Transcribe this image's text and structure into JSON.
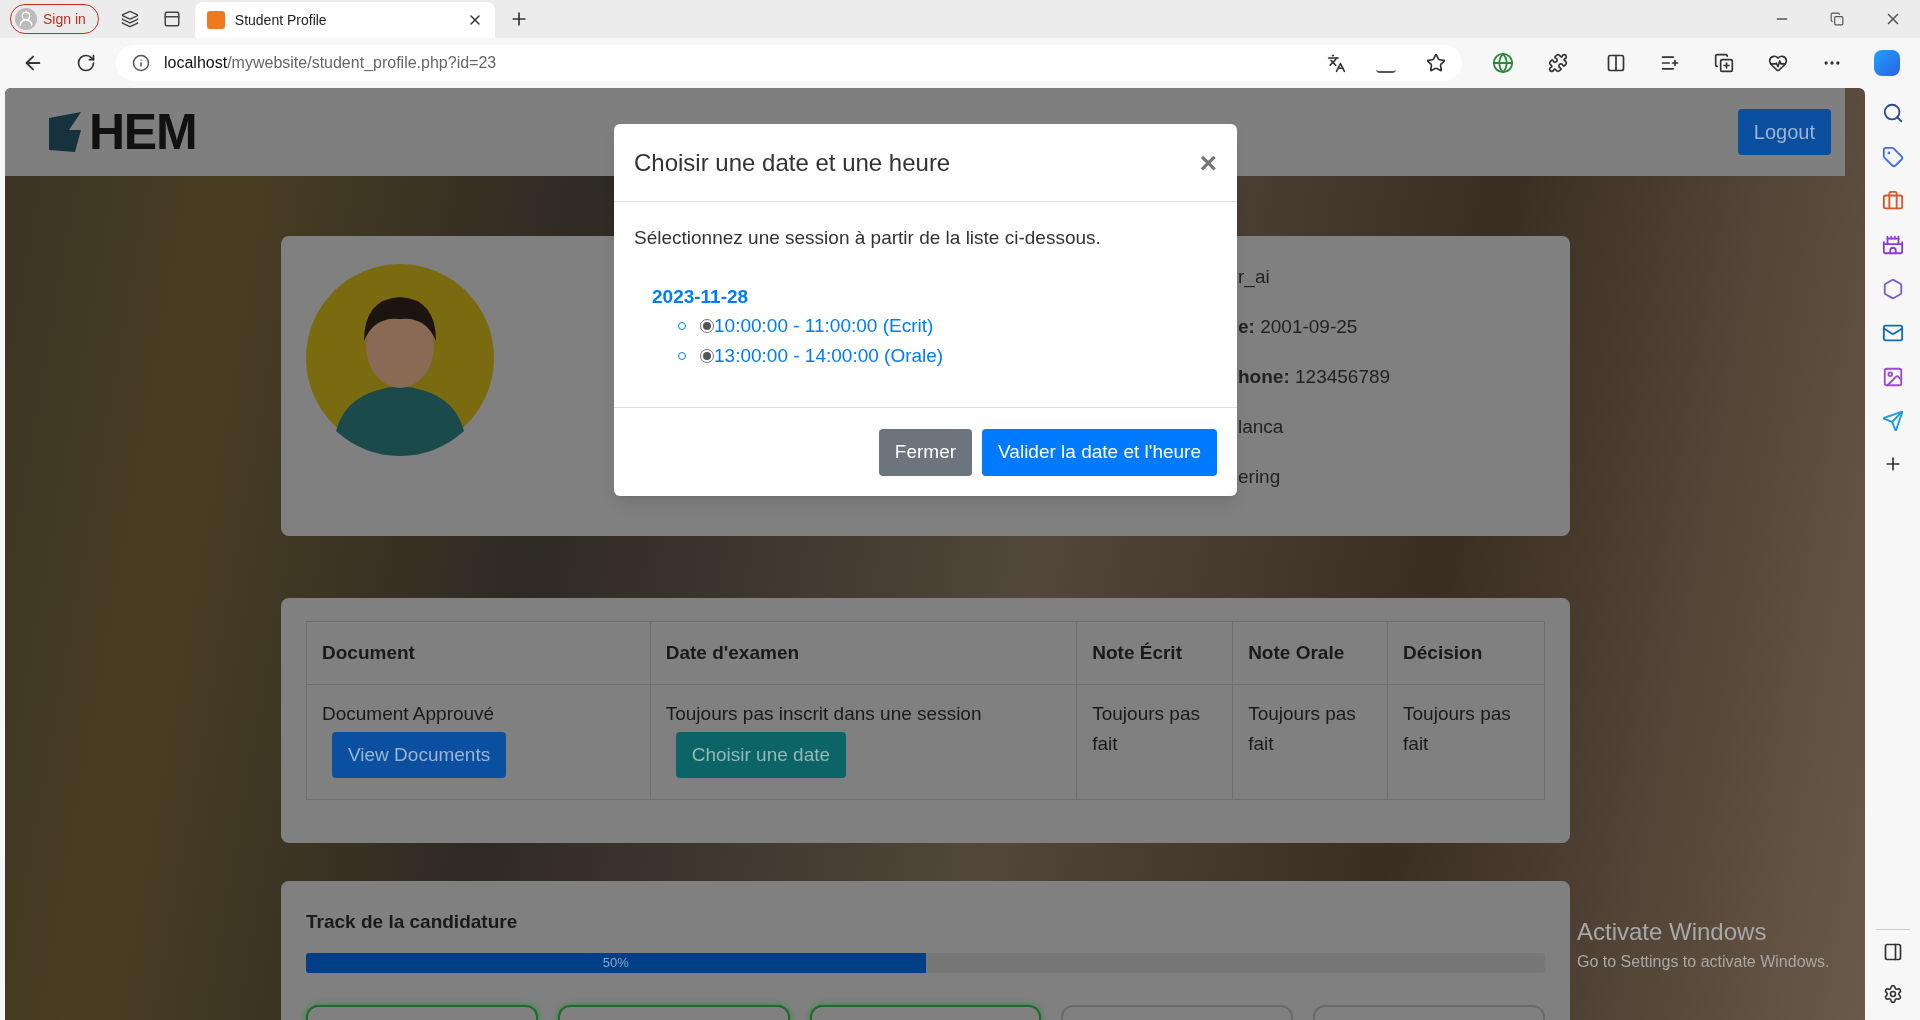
{
  "browser": {
    "sign_in": "Sign in",
    "tabs": [
      {
        "title": "Student Profile",
        "selected": true
      }
    ],
    "url_host": "localhost",
    "url_path": "/mywebsite/student_profile.php?id=23"
  },
  "header": {
    "logo": "HEM",
    "logout": "Logout"
  },
  "profile": {
    "fields": [
      {
        "value": "r_ai"
      },
      {
        "label": "e:",
        "value": "2001-09-25"
      },
      {
        "label": "hone:",
        "value": "123456789"
      },
      {
        "value": "lanca"
      },
      {
        "value": "ering"
      }
    ]
  },
  "table": {
    "columns": [
      "Document",
      "Date d'examen",
      "Note Écrit",
      "Note Orale",
      "Décision"
    ],
    "rows": [
      {
        "cells": [
          {
            "text": "Document Approuvé",
            "button": {
              "label": "View Documents",
              "kind": "primary"
            }
          },
          {
            "text": "Toujours pas inscrit dans une session",
            "button": {
              "label": "Choisir une date",
              "kind": "info"
            }
          },
          {
            "text": "Toujours pas fait"
          },
          {
            "text": "Toujours pas fait"
          },
          {
            "text": "Toujours pas fait"
          }
        ]
      }
    ]
  },
  "track": {
    "title": "Track de la candidature",
    "progress": {
      "level": 0.5,
      "label": "50%"
    },
    "steps": [
      {
        "done": true
      },
      {
        "done": true
      },
      {
        "done": true
      },
      {
        "done": false
      },
      {
        "done": false
      }
    ]
  },
  "modal": {
    "title": "Choisir une date et une heure",
    "close": "×",
    "instruction": "Sélectionnez une session à partir de la liste ci-dessous.",
    "dates": [
      {
        "date": "2023-11-28",
        "sessions": [
          "10:00:00 - 11:00:00 (Ecrit)",
          "13:00:00 - 14:00:00 (Orale)"
        ]
      }
    ],
    "buttons": [
      {
        "label": "Fermer",
        "kind": "secondary"
      },
      {
        "label": "Valider la date et l'heure",
        "kind": "primary"
      }
    ]
  },
  "os_notice": {
    "title": "Activate Windows",
    "subtitle": "Go to Settings to activate Windows."
  }
}
